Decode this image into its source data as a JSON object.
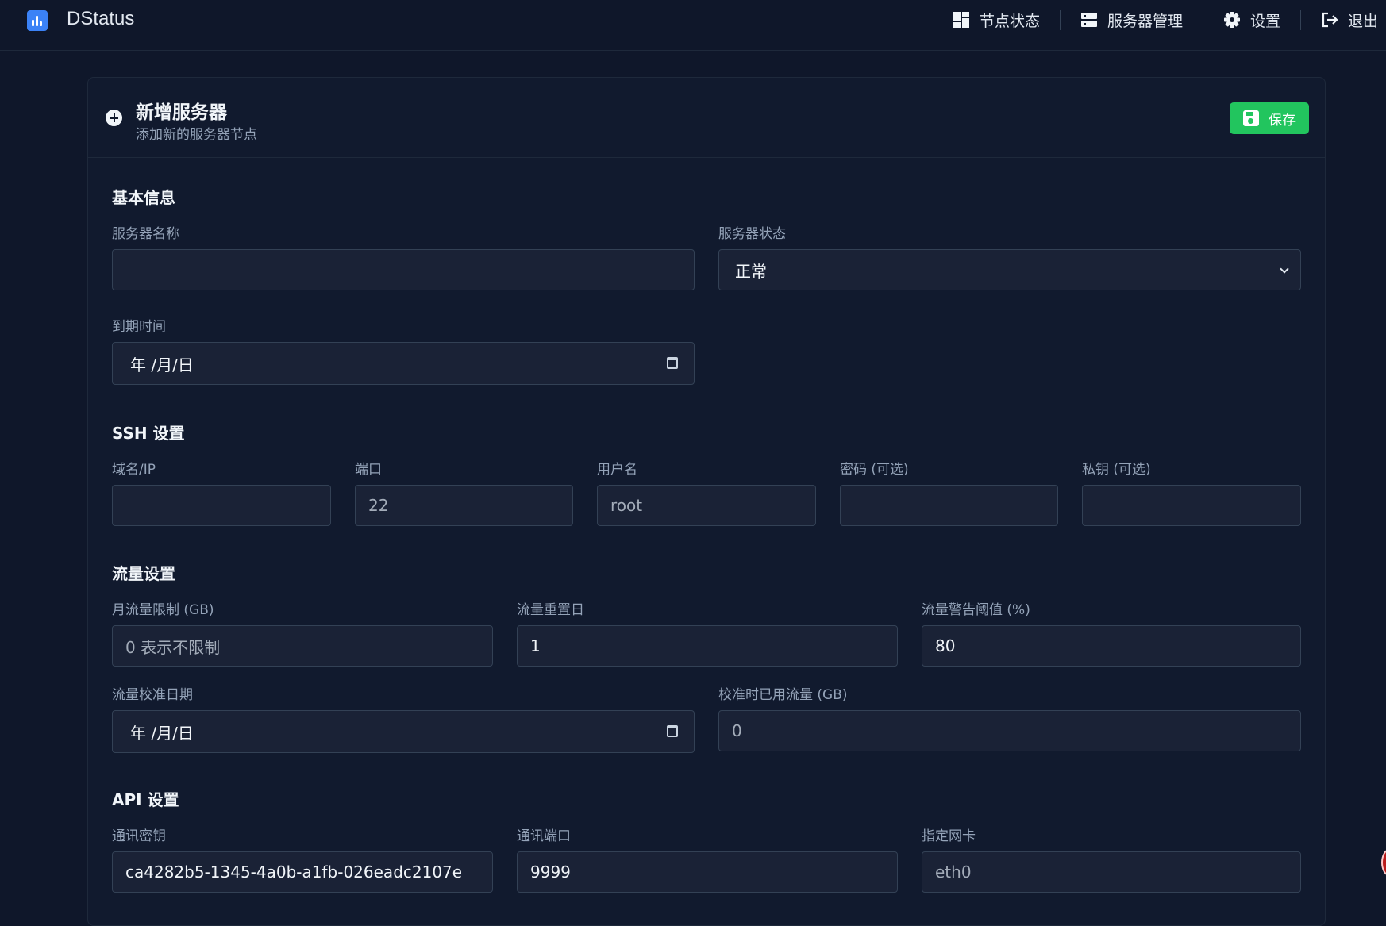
{
  "app": {
    "title": "DStatus"
  },
  "nav": {
    "items": [
      {
        "label": "节点状态",
        "icon": "dashboard-grid-icon"
      },
      {
        "label": "服务器管理",
        "icon": "server-icon"
      },
      {
        "label": "设置",
        "icon": "gear-icon"
      },
      {
        "label": "退出",
        "icon": "logout-icon"
      }
    ]
  },
  "card": {
    "title": "新增服务器",
    "subtitle": "添加新的服务器节点",
    "save_label": "保存"
  },
  "basic": {
    "title": "基本信息",
    "name_label": "服务器名称",
    "name_value": "",
    "status_label": "服务器状态",
    "status_value": "正常",
    "expire_label": "到期时间",
    "expire_value": "年 /月/日"
  },
  "ssh": {
    "title": "SSH 设置",
    "host_label": "域名/IP",
    "host_value": "",
    "port_label": "端口",
    "port_placeholder": "22",
    "user_label": "用户名",
    "user_placeholder": "root",
    "password_label": "密码 (可选)",
    "password_value": "",
    "key_label": "私钥 (可选)",
    "key_value": ""
  },
  "traffic": {
    "title": "流量设置",
    "limit_label": "月流量限制 (GB)",
    "limit_value": "0 表示不限制",
    "reset_label": "流量重置日",
    "reset_value": "1",
    "warn_label": "流量警告阈值 (%)",
    "warn_value": "80",
    "calib_date_label": "流量校准日期",
    "calib_date_value": "年 /月/日",
    "calib_used_label": "校准时已用流量 (GB)",
    "calib_used_value": "0"
  },
  "api": {
    "title": "API 设置",
    "key_label": "通讯密钥",
    "key_value": "ca4282b5-1345-4a0b-a1fb-026eadc2107e",
    "port_label": "通讯端口",
    "port_value": "9999",
    "nic_label": "指定网卡",
    "nic_placeholder": "eth0"
  },
  "colors": {
    "background": "#0f172a",
    "card": "#111a2e",
    "input": "#1a2236",
    "accent_logo": "#3b82f6",
    "save_button": "#22c55e"
  }
}
